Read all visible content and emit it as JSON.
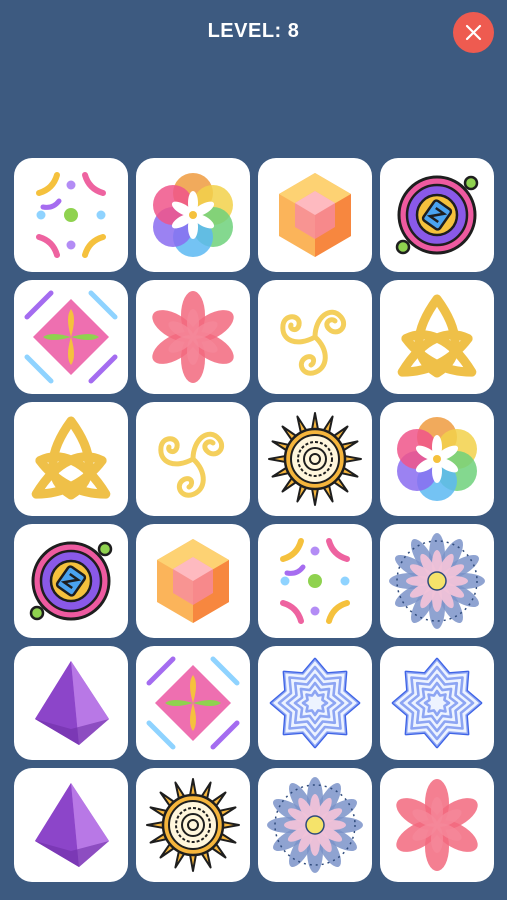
{
  "header": {
    "level_label": "LEVEL: 8",
    "close_icon": "close-icon"
  },
  "colors": {
    "background": "#3d5a80",
    "tile": "#ffffff",
    "close_button": "#ee5b50"
  },
  "board": {
    "columns": 4,
    "rows": 6,
    "tiles": [
      {
        "icon": "arcs-pattern"
      },
      {
        "icon": "color-flower"
      },
      {
        "icon": "orange-hexagon"
      },
      {
        "icon": "portal-ring"
      },
      {
        "icon": "diamond-leaf"
      },
      {
        "icon": "pink-flower"
      },
      {
        "icon": "triskele"
      },
      {
        "icon": "celtic-knot"
      },
      {
        "icon": "celtic-knot"
      },
      {
        "icon": "triskele"
      },
      {
        "icon": "sun-mandala"
      },
      {
        "icon": "color-flower"
      },
      {
        "icon": "portal-ring"
      },
      {
        "icon": "orange-hexagon"
      },
      {
        "icon": "arcs-pattern"
      },
      {
        "icon": "blue-mandala"
      },
      {
        "icon": "purple-pyramid"
      },
      {
        "icon": "diamond-leaf"
      },
      {
        "icon": "blue-star"
      },
      {
        "icon": "blue-star"
      },
      {
        "icon": "purple-pyramid"
      },
      {
        "icon": "sun-mandala"
      },
      {
        "icon": "blue-mandala"
      },
      {
        "icon": "pink-flower"
      }
    ]
  }
}
